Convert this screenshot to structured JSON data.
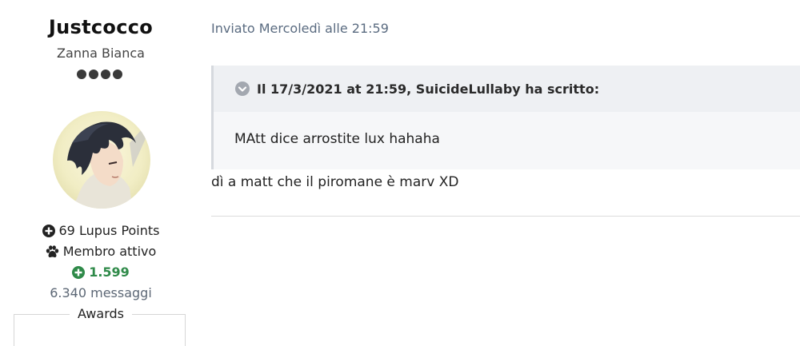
{
  "author": {
    "username": "Justcocco",
    "rank_title": "Zanna Bianca",
    "rank_pips": 4,
    "points": "69 Lupus Points",
    "status": "Membro attivo",
    "reputation": "1.599",
    "posts": "6.340 messaggi",
    "awards_label": "Awards"
  },
  "post": {
    "meta": "Inviato Mercoledì alle 21:59",
    "quote": {
      "header": "Il 17/3/2021 at 21:59, SuicideLullaby ha scritto:",
      "body": "MAtt dice arrostite lux hahaha"
    },
    "text": "dì a matt che il piromane è marv XD"
  },
  "colors": {
    "reputation": "#2f8a49",
    "meta": "#5a6b80",
    "quote_bg": "#f6f7f9",
    "quote_head_bg": "#eef0f3"
  },
  "icons": {
    "points": "plus-circle-icon",
    "status": "paw-icon",
    "reputation": "plus-circle-icon",
    "quote_toggle": "chevron-down-circle-icon"
  }
}
